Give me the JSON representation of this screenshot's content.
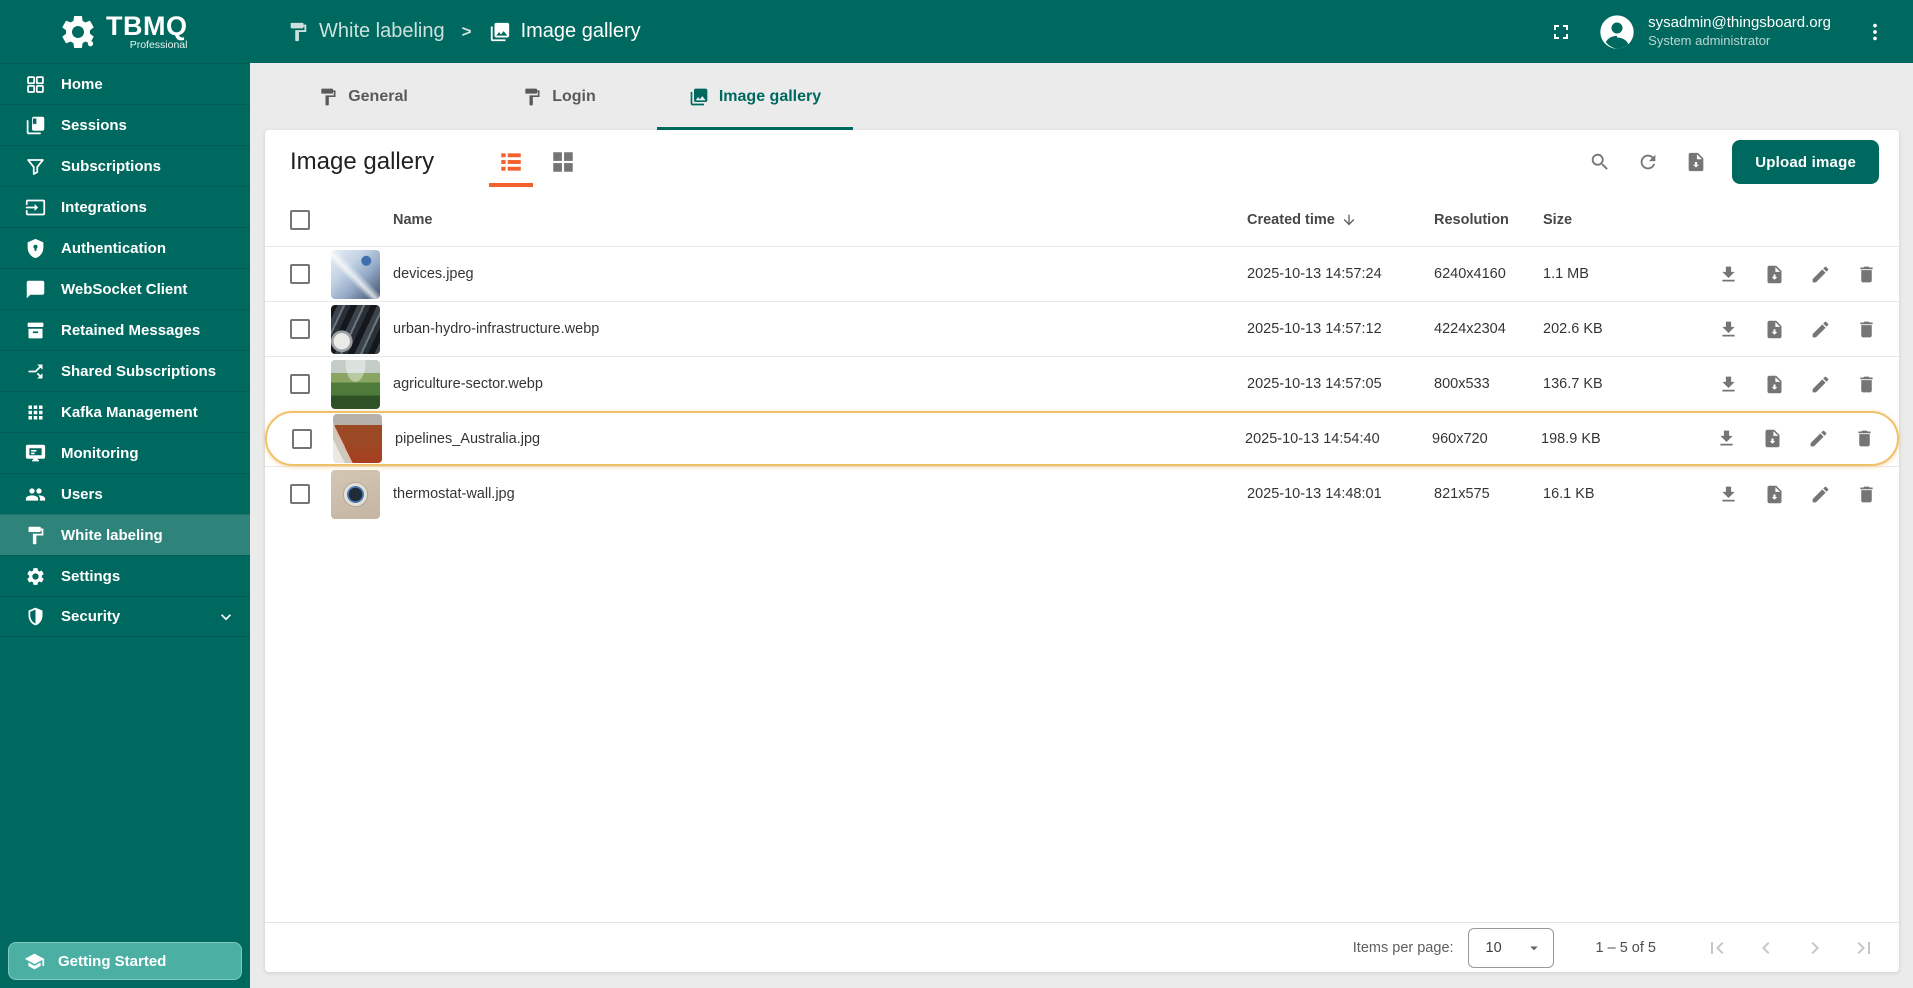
{
  "app": {
    "name": "TBMQ",
    "edition": "Professional"
  },
  "topbar": {
    "separator": ">",
    "breadcrumb": [
      {
        "label": "White labeling"
      },
      {
        "label": "Image gallery"
      }
    ],
    "user": {
      "email": "sysadmin@thingsboard.org",
      "role": "System administrator"
    }
  },
  "sidebar": {
    "items": [
      {
        "label": "Home"
      },
      {
        "label": "Sessions"
      },
      {
        "label": "Subscriptions"
      },
      {
        "label": "Integrations"
      },
      {
        "label": "Authentication"
      },
      {
        "label": "WebSocket Client"
      },
      {
        "label": "Retained Messages"
      },
      {
        "label": "Shared Subscriptions"
      },
      {
        "label": "Kafka Management"
      },
      {
        "label": "Monitoring"
      },
      {
        "label": "Users"
      },
      {
        "label": "White labeling",
        "active": true
      },
      {
        "label": "Settings"
      },
      {
        "label": "Security",
        "expandable": true
      }
    ],
    "getting_started": "Getting Started"
  },
  "tabs": [
    {
      "label": "General"
    },
    {
      "label": "Login"
    },
    {
      "label": "Image gallery",
      "active": true
    }
  ],
  "toolbar": {
    "title": "Image gallery",
    "upload_label": "Upload image"
  },
  "table": {
    "columns": {
      "name": "Name",
      "created": "Created time",
      "resolution": "Resolution",
      "size": "Size"
    },
    "sorted_by": "Created time",
    "sort_direction": "desc",
    "rows": [
      {
        "name": "devices.jpeg",
        "created": "2025-10-13 14:57:24",
        "resolution": "6240x4160",
        "size": "1.1 MB"
      },
      {
        "name": "urban-hydro-infrastructure.webp",
        "created": "2025-10-13 14:57:12",
        "resolution": "4224x2304",
        "size": "202.6 KB"
      },
      {
        "name": "agriculture-sector.webp",
        "created": "2025-10-13 14:57:05",
        "resolution": "800x533",
        "size": "136.7 KB"
      },
      {
        "name": "pipelines_Australia.jpg",
        "created": "2025-10-13 14:54:40",
        "resolution": "960x720",
        "size": "198.9 KB",
        "highlighted": true
      },
      {
        "name": "thermostat-wall.jpg",
        "created": "2025-10-13 14:48:01",
        "resolution": "821x575",
        "size": "16.1 KB"
      }
    ]
  },
  "pagination": {
    "items_per_page_label": "Items per page:",
    "items_per_page": "10",
    "range": "1 – 5 of 5"
  },
  "colors": {
    "primary_teal": "#00695f",
    "sidebar_active": "rgba(255,255,255,0.18)",
    "accent_orange": "#f4602e",
    "highlight_border": "#f0c169",
    "content_bg": "#ebebeb"
  }
}
